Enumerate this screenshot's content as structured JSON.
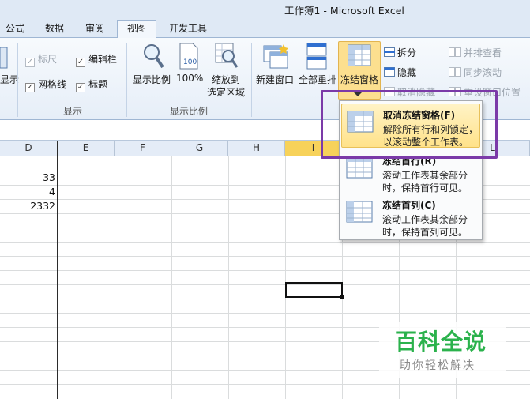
{
  "window": {
    "title": "工作簿1  -  Microsoft Excel"
  },
  "tabs": [
    "公式",
    "数据",
    "审阅",
    "视图",
    "开发工具"
  ],
  "ribbon": {
    "show_group": {
      "partial_label": "显示",
      "ruler": "标尺",
      "formula_bar": "编辑栏",
      "gridlines": "网格线",
      "headings": "标题",
      "group_label": "显示"
    },
    "zoom_group": {
      "zoom": "显示比例",
      "zoom100": "100%",
      "zoom_selection_line1": "缩放到",
      "zoom_selection_line2": "选定区域",
      "group_label": "显示比例"
    },
    "window_group": {
      "new_window": "新建窗口",
      "arrange_all": "全部重排",
      "freeze_panes": "冻结窗格",
      "split": "拆分",
      "hide": "隐藏",
      "unhide": "取消隐藏",
      "side_by_side": "并排查看",
      "sync_scroll": "同步滚动",
      "reset_position": "重设窗口位置"
    }
  },
  "grid": {
    "columns": [
      "D",
      "E",
      "F",
      "G",
      "H",
      "I",
      "J",
      "K",
      "L"
    ],
    "d_values": [
      "33",
      "4",
      "2332"
    ]
  },
  "freeze_menu": {
    "items": [
      {
        "title": "取消冻结窗格(F)",
        "desc1": "解除所有行和列锁定，",
        "desc2": "以滚动整个工作表。"
      },
      {
        "title": "冻结首行(R)",
        "desc1": "滚动工作表其余部分",
        "desc2": "时，保持首行可见。"
      },
      {
        "title": "冻结首列(C)",
        "desc1": "滚动工作表其余部分",
        "desc2": "时，保持首列可见。"
      }
    ]
  },
  "watermark": {
    "big": "百科全说",
    "small": "助你轻松解决"
  },
  "colors": {
    "accent_freeze": "#fcdf8f",
    "highlight_frame": "#7b3aa8",
    "watermark_green": "#2bb24c"
  }
}
